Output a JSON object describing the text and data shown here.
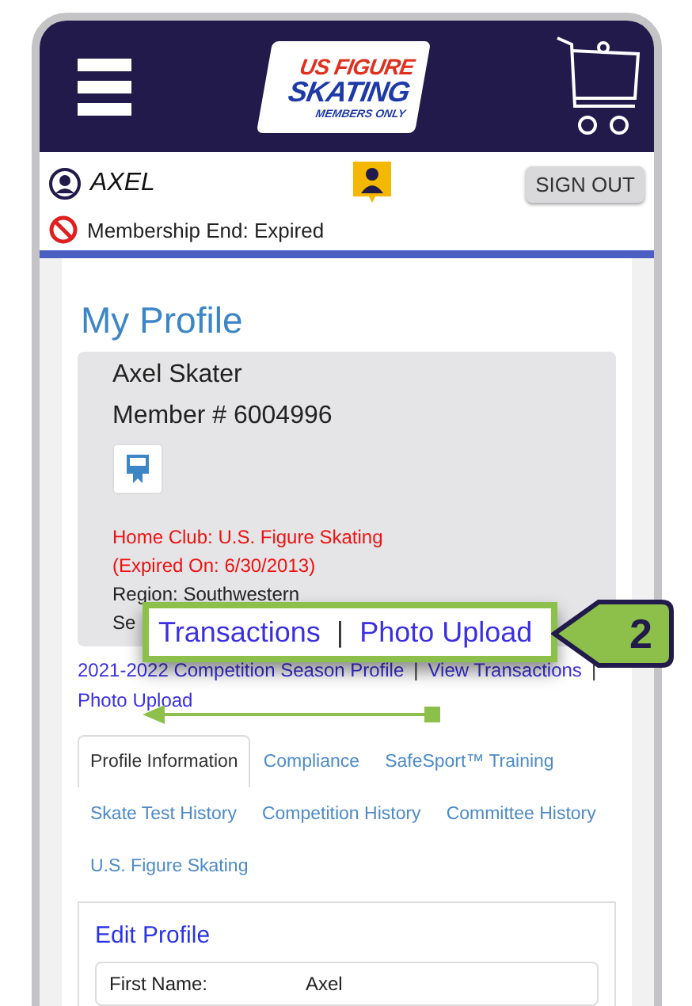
{
  "header": {
    "logo": {
      "line_1": "US FIGURE",
      "line_2": "SKATING",
      "line_3": "MEMBERS ONLY"
    }
  },
  "user": {
    "name": "AXEL",
    "sign_out": "SIGN OUT",
    "membership": "Membership End: Expired"
  },
  "profile": {
    "title": "My Profile",
    "name": "Axel Skater",
    "member_number": "Member # 6004996",
    "home_club_label": "Home Club:",
    "home_club": "U.S. Figure Skating",
    "expired": "(Expired On: 6/30/2013)",
    "region": "Region: Southwestern",
    "section": "Se"
  },
  "links": [
    {
      "label": "2021-2022 Competition Season Profile"
    },
    {
      "label": "View Transactions"
    },
    {
      "label": "Photo Upload"
    }
  ],
  "separator": "|",
  "tabs": [
    {
      "label": "Profile Information",
      "selected": true
    },
    {
      "label": "Compliance",
      "selected": false
    },
    {
      "label": "SafeSport™ Training",
      "selected": false
    },
    {
      "label": "Skate Test History",
      "selected": false
    },
    {
      "label": "Competition History",
      "selected": false
    },
    {
      "label": "Committee History",
      "selected": false
    },
    {
      "label": "U.S. Figure Skating",
      "selected": false
    }
  ],
  "edit_profile": {
    "title": "Edit Profile",
    "fields": [
      {
        "label": "First Name:",
        "value": "Axel"
      }
    ]
  },
  "callout": {
    "links": [
      "Transactions",
      "Photo Upload"
    ],
    "separator": "|",
    "step": "2"
  }
}
